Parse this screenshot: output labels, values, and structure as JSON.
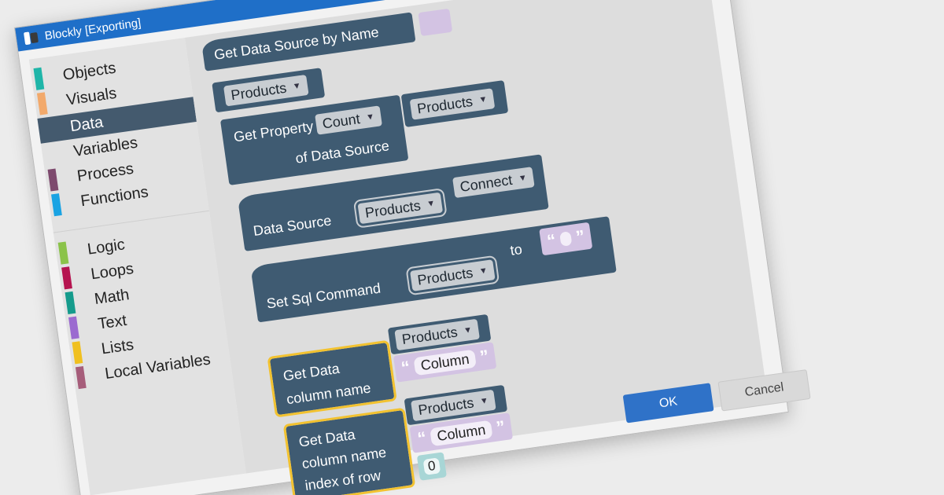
{
  "window": {
    "title": "Blockly [Exporting]"
  },
  "toolbox": {
    "items": [
      {
        "label": "Objects",
        "color": "#1fb5a8"
      },
      {
        "label": "Visuals",
        "color": "#f2a96b"
      },
      {
        "label": "Data",
        "color": "#445a6e"
      },
      {
        "label": "Variables",
        "color": "#e2e2e2"
      },
      {
        "label": "Process",
        "color": "#7e4a6e"
      },
      {
        "label": "Functions",
        "color": "#1aa3e3"
      },
      {
        "label": "Logic",
        "color": "#8bc34a"
      },
      {
        "label": "Loops",
        "color": "#b5134f"
      },
      {
        "label": "Math",
        "color": "#159b8c"
      },
      {
        "label": "Text",
        "color": "#9b6ad0"
      },
      {
        "label": "Lists",
        "color": "#f0c020"
      },
      {
        "label": "Local Variables",
        "color": "#a65d7a"
      }
    ]
  },
  "blocks": {
    "get_ds_by_name": {
      "label": "Get Data Source by Name"
    },
    "products_value": {
      "value": "Products"
    },
    "get_property": {
      "label_a": "Get Property",
      "property": "Count",
      "label_b": "of Data Source",
      "source": "Products"
    },
    "data_source": {
      "label": "Data Source",
      "source": "Products",
      "action": "Connect"
    },
    "set_sql": {
      "label": "Set Sql Command",
      "source": "Products",
      "to": "to",
      "open_quote": "“",
      "close_quote": "”"
    },
    "get_data_1": {
      "label_a": "Get Data",
      "label_b": "column name",
      "source": "Products",
      "open_quote": "“",
      "column": "Column",
      "close_quote": "”"
    },
    "get_data_2": {
      "label_a": "Get Data",
      "label_b": "column name",
      "label_c": "index of row",
      "source": "Products",
      "open_quote": "“",
      "column": "Column",
      "close_quote": "”",
      "row": "0"
    }
  },
  "buttons": {
    "ok": "OK",
    "cancel": "Cancel"
  },
  "colors": {
    "titlebar": "#1f6fc8",
    "block": "#3f5b72",
    "highlight": "#f2c230",
    "string": "#d3c3e3",
    "number": "#a8d6d6",
    "primary": "#2f72c8"
  }
}
